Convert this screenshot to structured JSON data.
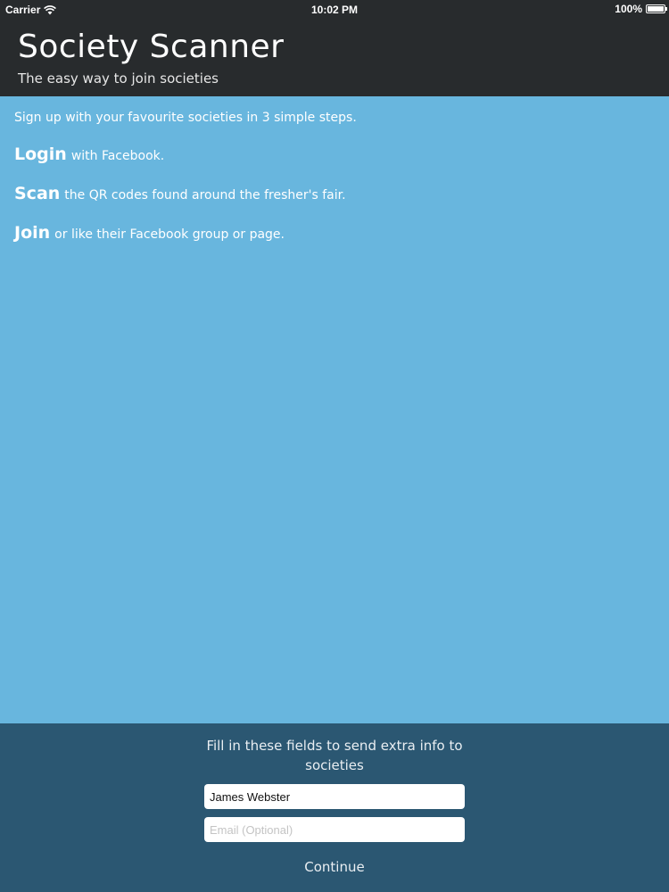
{
  "status_bar": {
    "carrier": "Carrier",
    "time": "10:02 PM",
    "battery": "100%",
    "battery_level": 1.0,
    "icons": [
      "wifi-icon",
      "battery-icon"
    ]
  },
  "header": {
    "title": "Society Scanner",
    "subtitle": "The easy way to join societies"
  },
  "content": {
    "intro": "Sign up with your favourite societies in 3 simple steps.",
    "steps": [
      {
        "word": "Login",
        "text": "with Facebook."
      },
      {
        "word": "Scan",
        "text": "the QR codes found around the fresher's fair."
      },
      {
        "word": "Join",
        "text": "or like their Facebook group or page."
      }
    ]
  },
  "form": {
    "prompt": "Fill in these fields to send extra info to societies",
    "name_value": "James Webster",
    "email_value": "",
    "email_placeholder": "Email (Optional)",
    "continue_label": "Continue"
  },
  "colors": {
    "header_bg": "#282b2d",
    "content_bg": "#68b6de",
    "footer_bg": "#2b5772"
  }
}
